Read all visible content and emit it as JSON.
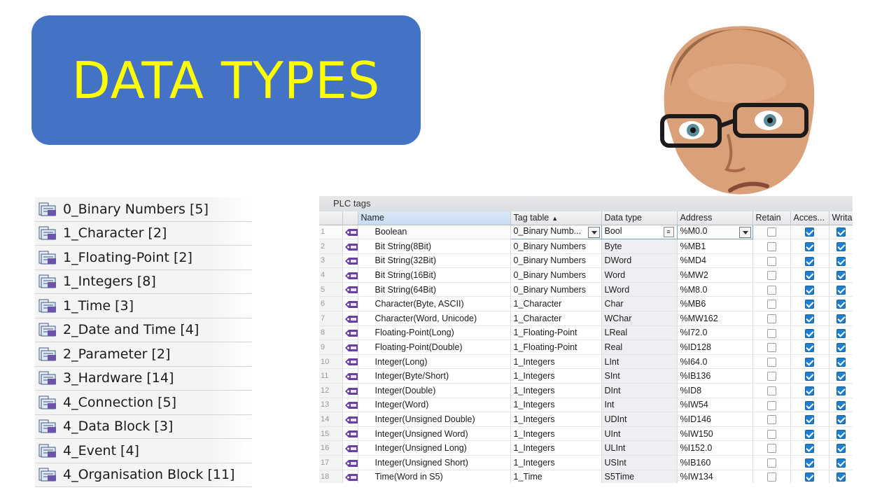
{
  "banner": {
    "title": "DATA TYPES"
  },
  "tag_tables": [
    {
      "label": "0_Binary Numbers [5]"
    },
    {
      "label": "1_Character [2]"
    },
    {
      "label": "1_Floating-Point [2]"
    },
    {
      "label": "1_Integers [8]"
    },
    {
      "label": "1_Time [3]"
    },
    {
      "label": "2_Date and Time [4]"
    },
    {
      "label": "2_Parameter [2]"
    },
    {
      "label": "3_Hardware [14]"
    },
    {
      "label": "4_Connection [5]"
    },
    {
      "label": "4_Data Block [3]"
    },
    {
      "label": "4_Event [4]"
    },
    {
      "label": "4_Organisation Block [11]"
    }
  ],
  "plc": {
    "title": "PLC tags",
    "headers": {
      "name": "Name",
      "tag_table": "Tag table",
      "sort_indicator": "▲",
      "data_type": "Data type",
      "address": "Address",
      "retain": "Retain",
      "accessible": "Acces...",
      "writable": "Writa"
    },
    "rows": [
      {
        "num": "1",
        "name": "Boolean",
        "table": "0_Binary Numb...",
        "type": "Bool",
        "address": "%M0.0"
      },
      {
        "num": "2",
        "name": "Bit String(8Bit)",
        "table": "0_Binary Numbers",
        "type": "Byte",
        "address": "%MB1"
      },
      {
        "num": "3",
        "name": "Bit String(32Bit)",
        "table": "0_Binary Numbers",
        "type": "DWord",
        "address": "%MD4"
      },
      {
        "num": "4",
        "name": "Bit String(16Bit)",
        "table": "0_Binary Numbers",
        "type": "Word",
        "address": "%MW2"
      },
      {
        "num": "5",
        "name": "Bit String(64Bit)",
        "table": "0_Binary Numbers",
        "type": "LWord",
        "address": "%M8.0"
      },
      {
        "num": "6",
        "name": "Character(Byte, ASCII)",
        "table": "1_Character",
        "type": "Char",
        "address": "%MB6"
      },
      {
        "num": "7",
        "name": "Character(Word, Unicode)",
        "table": "1_Character",
        "type": "WChar",
        "address": "%MW162"
      },
      {
        "num": "8",
        "name": "Floating-Point(Long)",
        "table": "1_Floating-Point",
        "type": "LReal",
        "address": "%I72.0"
      },
      {
        "num": "9",
        "name": "Floating-Point(Double)",
        "table": "1_Floating-Point",
        "type": "Real",
        "address": "%ID128"
      },
      {
        "num": "10",
        "name": "Integer(Long)",
        "table": "1_Integers",
        "type": "LInt",
        "address": "%I64.0"
      },
      {
        "num": "11",
        "name": "Integer(Byte/Short)",
        "table": "1_Integers",
        "type": "SInt",
        "address": "%IB136"
      },
      {
        "num": "12",
        "name": "Integer(Double)",
        "table": "1_Integers",
        "type": "DInt",
        "address": "%ID8"
      },
      {
        "num": "13",
        "name": "Integer(Word)",
        "table": "1_Integers",
        "type": "Int",
        "address": "%IW54"
      },
      {
        "num": "14",
        "name": "Integer(Unsigned Double)",
        "table": "1_Integers",
        "type": "UDInt",
        "address": "%ID146"
      },
      {
        "num": "15",
        "name": "Integer(Unsigned Word)",
        "table": "1_Integers",
        "type": "UInt",
        "address": "%IW150"
      },
      {
        "num": "16",
        "name": "Integer(Unsigned Long)",
        "table": "1_Integers",
        "type": "ULInt",
        "address": "%I152.0"
      },
      {
        "num": "17",
        "name": "Integer(Unsigned Short)",
        "table": "1_Integers",
        "type": "USInt",
        "address": "%IB160"
      },
      {
        "num": "18",
        "name": "Time(Word in S5)",
        "table": "1_Time",
        "type": "S5Time",
        "address": "%IW134"
      }
    ]
  }
}
